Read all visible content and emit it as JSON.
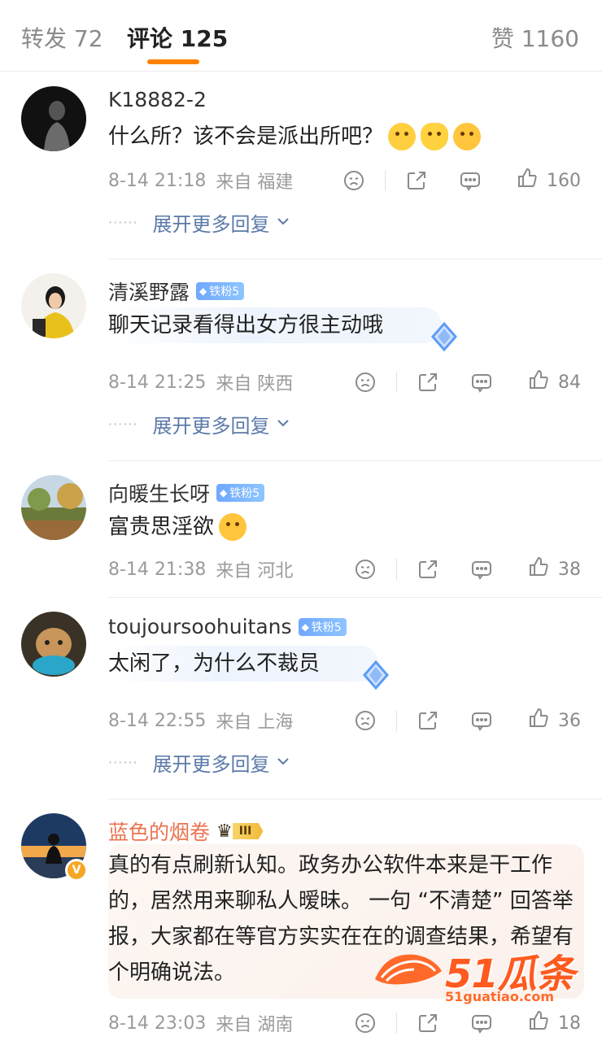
{
  "tabs": {
    "repost": "转发 72",
    "comments": "评论 125",
    "likes": "赞 1160"
  },
  "colors": {
    "accent": "#ff8200",
    "link": "#5b7aa8",
    "vip_name": "#eb7350",
    "fan_badge": "#7ab2ff"
  },
  "expand_label": "展开更多回复",
  "expand_dots": "······",
  "comments": [
    {
      "user": "K18882-2",
      "text": "什么所？该不会是派出所吧？",
      "emoji": [
        "laugh-cry-emoji",
        "hug-emoji",
        "kiss-emoji"
      ],
      "time": "8-14 21:18",
      "location": "来自 福建",
      "likes": "160",
      "has_replies": true
    },
    {
      "user": "清溪野露",
      "badge": "铁粉5",
      "text": "聊天记录看得出女方很主动哦",
      "time": "8-14 21:25",
      "location": "来自 陕西",
      "likes": "84",
      "has_replies": true
    },
    {
      "user": "向暖生长呀",
      "badge": "铁粉5",
      "text": "富贵思淫欲",
      "emoji": [
        "tongue-emoji"
      ],
      "time": "8-14 21:38",
      "location": "来自 河北",
      "likes": "38",
      "has_replies": false
    },
    {
      "user": "toujoursoohuitans",
      "badge": "铁粉5",
      "text": "太闲了，为什么不裁员",
      "time": "8-14 22:55",
      "location": "来自 上海",
      "likes": "36",
      "has_replies": true
    },
    {
      "user": "蓝色的烟卷",
      "vip_level": "III",
      "verified": "V",
      "text": "真的有点刷新认知。政务办公软件本来是干工作的，居然用来聊私人暧昧。 一句 “不清楚” 回答举报，大家都在等官方实实在在的调查结果，希望有个明确说法。",
      "time": "8-14 23:03",
      "location": "来自 湖南",
      "likes": "18"
    }
  ],
  "watermark": {
    "brand": "51瓜条",
    "url": "51guatiao.com"
  }
}
